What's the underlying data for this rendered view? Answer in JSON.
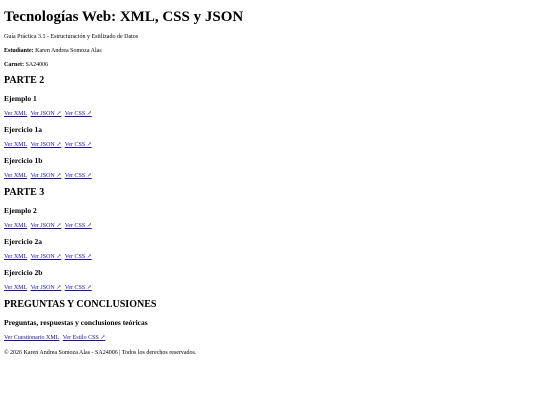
{
  "title": "Tecnologías Web: XML, CSS y JSON",
  "subtitle": "Guía Práctica 3.1 - Estructuración y Estilizado de Datos",
  "student_label": "Estudiante:",
  "student_name": "Karen Andrea Somoza Alas",
  "carnet_label": "Carnet:",
  "carnet_value": "SA24006",
  "sections": [
    {
      "heading": "PARTE 2",
      "examples": [
        {
          "title": "Ejemplo 1",
          "links": [
            "Ver XML",
            "Ver JSON ↗",
            "Ver CSS ↗"
          ]
        },
        {
          "title": "Ejercicio 1a",
          "links": [
            "Ver XML",
            "Ver JSON ↗",
            "Ver CSS ↗"
          ]
        },
        {
          "title": "Ejercicio 1b",
          "links": [
            "Ver XML",
            "Ver JSON ↗",
            "Ver CSS ↗"
          ]
        }
      ]
    },
    {
      "heading": "PARTE 3",
      "examples": [
        {
          "title": "Ejemplo 2",
          "links": [
            "Ver XML",
            "Ver JSON ↗",
            "Ver CSS ↗"
          ]
        },
        {
          "title": "Ejercicio 2a",
          "links": [
            "Ver XML",
            "Ver JSON ↗",
            "Ver CSS ↗"
          ]
        },
        {
          "title": "Ejercicio 2b",
          "links": [
            "Ver XML",
            "Ver JSON ↗",
            "Ver CSS ↗"
          ]
        }
      ]
    },
    {
      "heading": "PREGUNTAS Y CONCLUSIONES",
      "examples": [
        {
          "title": "Preguntas, respuestas y conclusiones teóricas",
          "links": [
            "Ver Cuestionario XML",
            "Ver Estilo CSS ↗"
          ]
        }
      ]
    }
  ],
  "footer": "© 2026 Karen Andrea Somoza Alas - SA24006 | Todos los derechos reservados.",
  "colors": {
    "link": "#1a0dab",
    "text": "#000000",
    "background": "#ffffff"
  }
}
